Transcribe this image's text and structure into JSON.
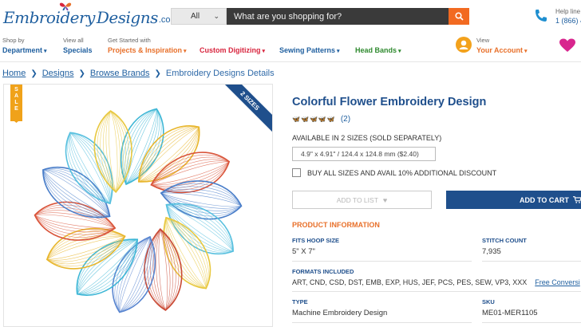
{
  "header": {
    "logo_main": "Embroidery",
    "logo_second": "Designs",
    "logo_com": ".com",
    "search_category": "All",
    "search_placeholder": "What are you shopping for?",
    "help_label": "Help line",
    "help_phone": "1 (866) 4"
  },
  "nav": {
    "items": [
      {
        "small": "Shop by",
        "label": "Department"
      },
      {
        "small": "View all",
        "label": "Specials"
      },
      {
        "small": "Get Started with",
        "label": "Projects & Inspiration"
      },
      {
        "small": "",
        "label": "Custom Digitizing"
      },
      {
        "small": "",
        "label": "Sewing Patterns"
      },
      {
        "small": "",
        "label": "Head Bands"
      }
    ],
    "account_small": "View",
    "account_label": "Your Account"
  },
  "breadcrumb": [
    "Home",
    "Designs",
    "Browse Brands",
    "Embroidery Designs Details"
  ],
  "badges": {
    "sale": [
      "S",
      "A",
      "L",
      "E"
    ],
    "sizes_ribbon": "2 SIZES"
  },
  "product": {
    "title": "Colorful Flower Embroidery Design",
    "review_count": "(2)",
    "rating": 5,
    "available_text": "AVAILABLE IN 2 SIZES (SOLD SEPARATELY)",
    "size_option": "4.9\" x 4.91\" / 124.4 x 124.8 mm ($2.40)",
    "bundle_label": "BUY ALL SIZES AND AVAIL 10% ADDITIONAL DISCOUNT",
    "add_to_list": "ADD TO LIST",
    "add_to_cart": "ADD TO CART",
    "info_heading": "PRODUCT INFORMATION",
    "fits_hoop_label": "FITS HOOP SIZE",
    "fits_hoop_value": "5\" X 7\"",
    "stitch_label": "STITCH COUNT",
    "stitch_value": "7,935",
    "formats_label": "FORMATS INCLUDED",
    "formats_value": "ART, CND, CSD, DST, EMB, EXP, HUS, JEF, PCS, PES, SEW, VP3, XXX",
    "free_conversion": "Free Conversi",
    "type_label": "TYPE",
    "type_value": "Machine Embroidery Design",
    "sku_label": "SKU",
    "sku_value": "ME01-MER1105"
  },
  "colors": {
    "brand_blue": "#1f4f8c",
    "accent_orange": "#e8702a",
    "search_button": "#f26a21",
    "sale_badge": "#f0a21a"
  }
}
